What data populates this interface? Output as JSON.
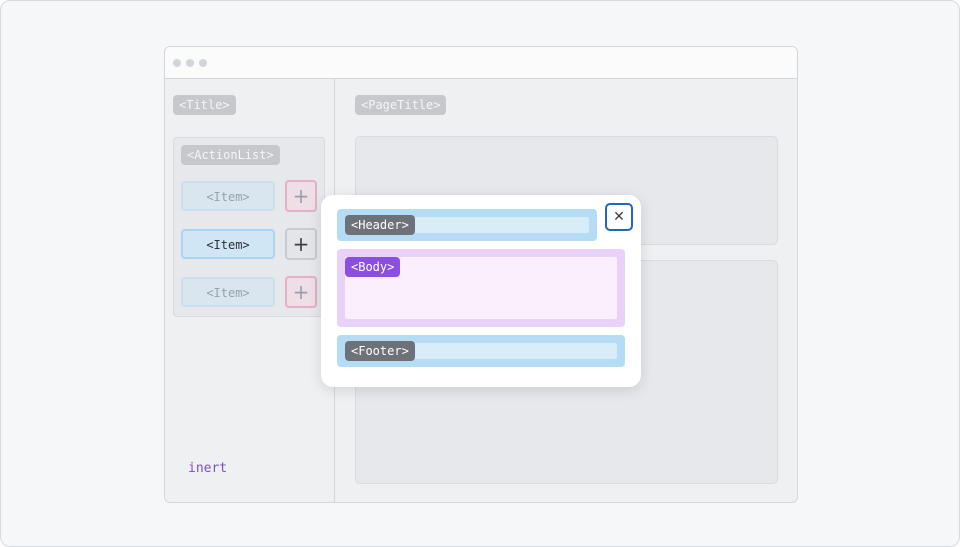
{
  "sidebar": {
    "title_tag": "<Title>",
    "actionlist_tag": "<ActionList>",
    "items": [
      {
        "label": "<Item>",
        "state": "faded"
      },
      {
        "label": "<Item>",
        "state": "active"
      },
      {
        "label": "<Item>",
        "state": "faded"
      }
    ],
    "add_icon": "+",
    "inert_label": "inert"
  },
  "main": {
    "page_title_tag": "<PageTitle>"
  },
  "dialog": {
    "header_tag": "<Header>",
    "body_tag": "<Body>",
    "footer_tag": "<Footer>",
    "close_icon": "✕"
  },
  "colors": {
    "region_blue": "#b4dcf4",
    "region_purple": "#ead1f7",
    "focus_ring": "#2564c0",
    "inert_text": "#7b4fc4"
  }
}
